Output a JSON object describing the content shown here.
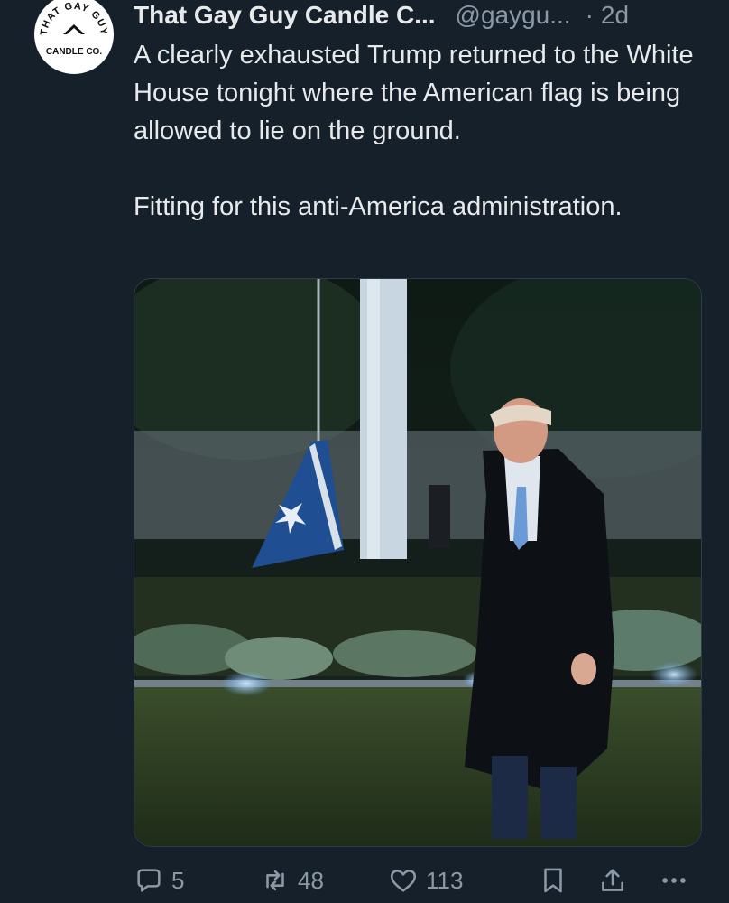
{
  "tweet": {
    "avatar": {
      "top_text": "THAT GAY GUY",
      "bottom_text": "CANDLE CO."
    },
    "author": {
      "display_name": "That Gay Guy Candle C...",
      "handle": "@gaygu...",
      "separator": "·",
      "time": "2d"
    },
    "text": {
      "paragraph_1": "A clearly exhausted Trump returned to the White House tonight where the American flag is being allowed to lie on the ground.",
      "paragraph_2": "Fitting for this anti-America administration."
    },
    "actions": {
      "replies": "5",
      "retweets": "48",
      "likes": "113"
    },
    "icons": {
      "reply": "reply-icon",
      "retweet": "retweet-icon",
      "like": "heart-icon",
      "bookmark": "bookmark-icon",
      "share": "share-icon",
      "more": "more-icon"
    },
    "colors": {
      "background": "#15202b",
      "text": "#e7e9ea",
      "secondary": "#8b98a5"
    }
  }
}
